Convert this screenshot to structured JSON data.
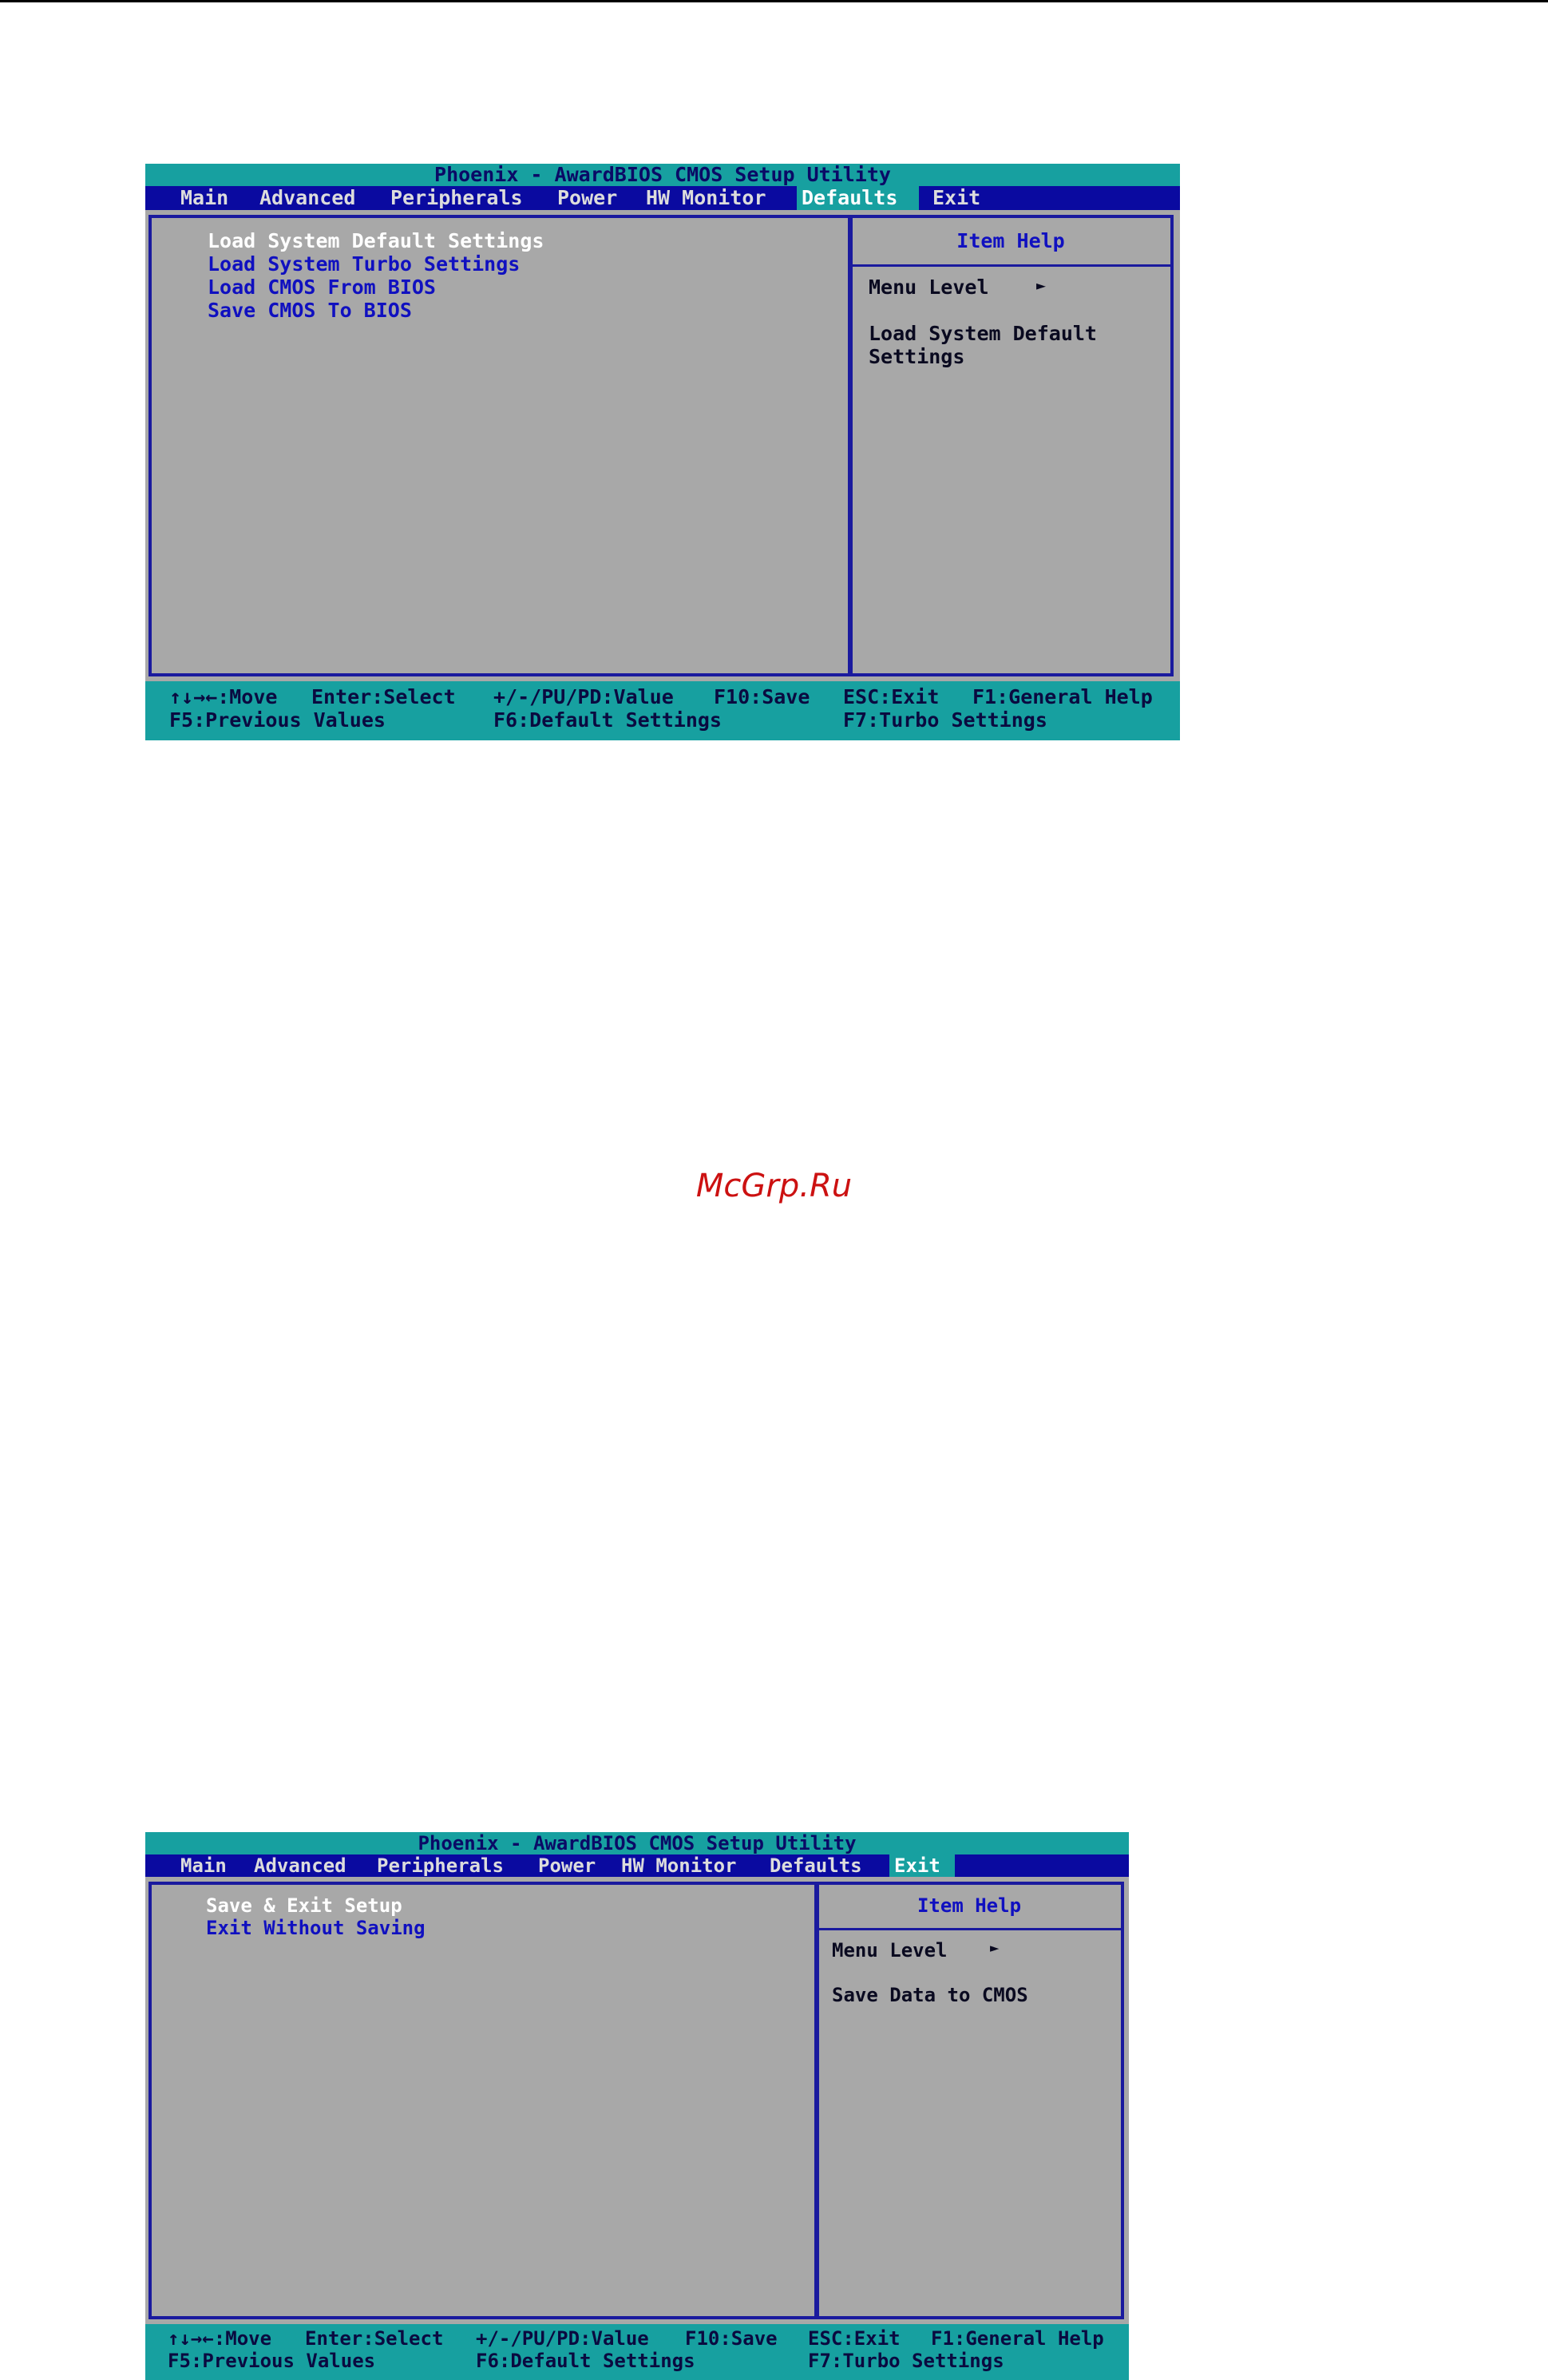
{
  "screens": [
    {
      "title": "Phoenix - AwardBIOS CMOS Setup Utility",
      "menu": [
        "Main",
        "Advanced",
        "Peripherals",
        "Power",
        "HW Monitor",
        "Defaults",
        "Exit"
      ],
      "active_menu": "Defaults",
      "items": [
        "Load System Default Settings",
        "Load System Turbo Settings",
        "Load CMOS From BIOS",
        "Save CMOS To BIOS"
      ],
      "selected_item": "Load System Default Settings",
      "help": {
        "title": "Item Help",
        "menu_level": "Menu Level",
        "menu_level_arrow": "►",
        "text_lines": [
          "Load System Default",
          "Settings"
        ]
      },
      "footer": {
        "row1": [
          "↑↓→←:Move",
          "Enter:Select",
          "+/-/PU/PD:Value",
          "F10:Save",
          "ESC:Exit",
          "F1:General Help"
        ],
        "row2": [
          "F5:Previous Values",
          "F6:Default Settings",
          "F7:Turbo Settings"
        ]
      }
    },
    {
      "title": "Phoenix - AwardBIOS CMOS Setup Utility",
      "menu": [
        "Main",
        "Advanced",
        "Peripherals",
        "Power",
        "HW Monitor",
        "Defaults",
        "Exit"
      ],
      "active_menu": "Exit",
      "items": [
        "Save & Exit Setup",
        "Exit Without Saving"
      ],
      "selected_item": "Save & Exit Setup",
      "help": {
        "title": "Item Help",
        "menu_level": "Menu Level",
        "menu_level_arrow": "►",
        "text_lines": [
          "Save Data to CMOS"
        ]
      },
      "footer": {
        "row1": [
          "↑↓→←:Move",
          "Enter:Select",
          "+/-/PU/PD:Value",
          "F10:Save",
          "ESC:Exit",
          "F1:General Help"
        ],
        "row2": [
          "F5:Previous Values",
          "F6:Default Settings",
          "F7:Turbo Settings"
        ]
      }
    }
  ],
  "watermark": "McGrp.Ru"
}
